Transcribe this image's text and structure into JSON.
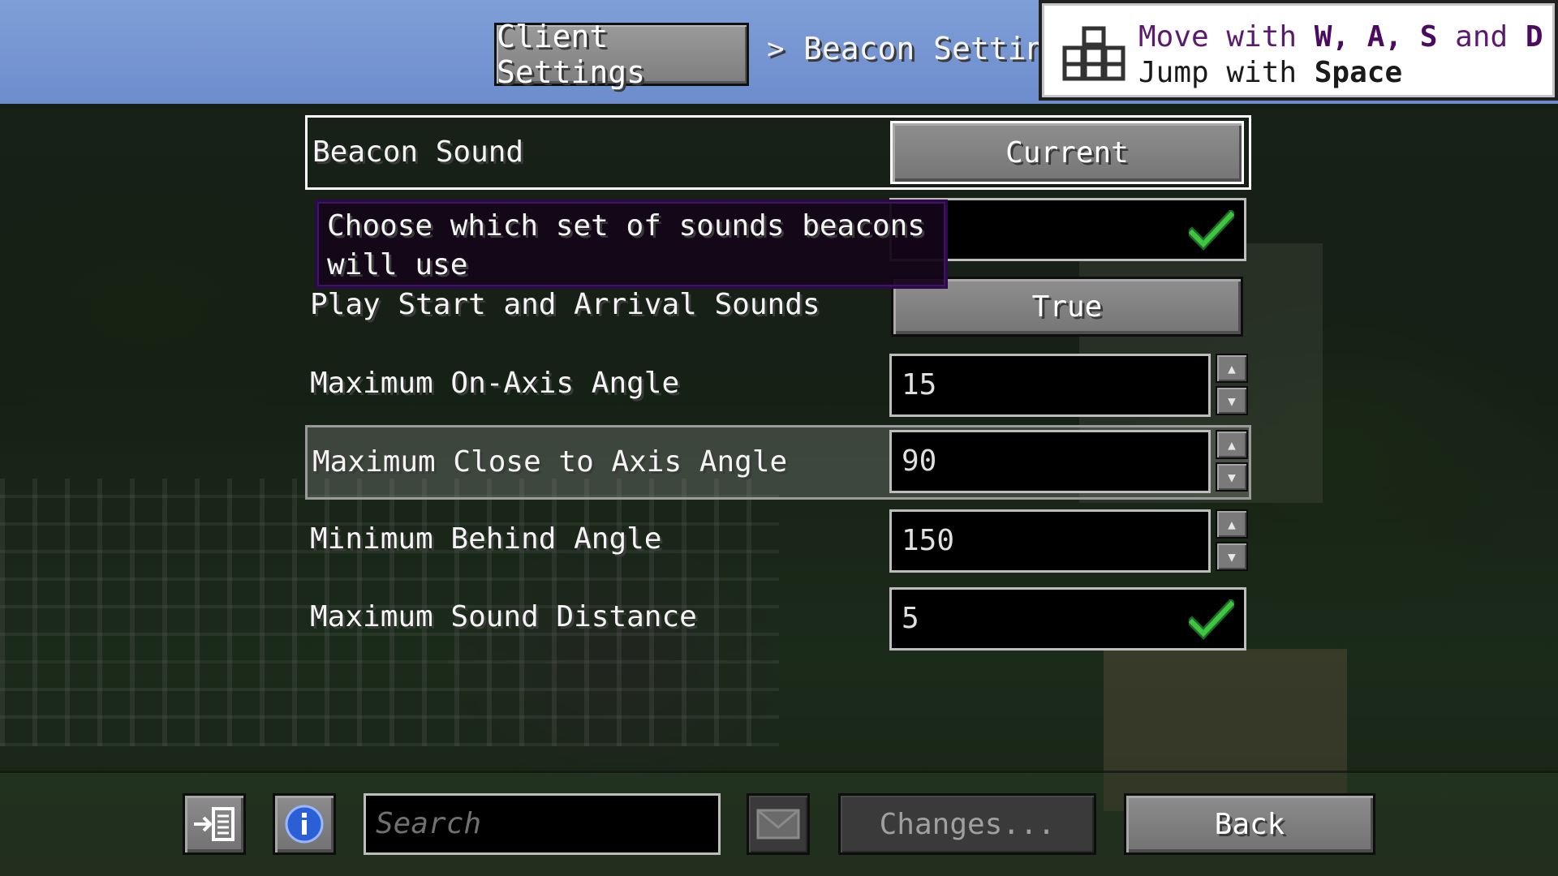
{
  "breadcrumb": {
    "parent": "Client Settings",
    "separator": ">",
    "current": "Beacon Settings"
  },
  "toast": {
    "line1_prefix": "Move with ",
    "line1_keys": "W, A, S",
    "line1_and": " and ",
    "line1_key_last": "D",
    "line2_prefix": "Jump with ",
    "line2_key": "Space"
  },
  "settings": [
    {
      "label": "Beacon Sound",
      "control": "button",
      "value": "Current"
    },
    {
      "label": "",
      "control": "toggle",
      "value": ""
    },
    {
      "label": "Play Start and Arrival Sounds",
      "control": "button",
      "value": "True"
    },
    {
      "label": "Maximum On-Axis Angle",
      "control": "number",
      "value": "15"
    },
    {
      "label": "Maximum Close to Axis Angle",
      "control": "number",
      "value": "90"
    },
    {
      "label": "Minimum Behind Angle",
      "control": "number",
      "value": "150"
    },
    {
      "label": "Maximum Sound Distance",
      "control": "field",
      "value": "5"
    }
  ],
  "tooltip": {
    "line1": "Choose which set of sounds beacons",
    "line2": "will use"
  },
  "footer": {
    "search_placeholder": "Search",
    "changes_label": "Changes...",
    "back_label": "Back"
  },
  "icons": {
    "toast": "keyboard-keys-icon",
    "check": "checkmark-icon",
    "info": "info-icon",
    "export": "export-list-icon",
    "mail": "envelope-icon",
    "spin_up": "arrow-up-icon",
    "spin_down": "arrow-down-icon"
  },
  "colors": {
    "tooltip_bg": "#140518",
    "tooltip_border": "#2c0a47",
    "check_green": "#3ec63e",
    "info_blue": "#2b5fd6",
    "toast_text": "#5a1a6e"
  }
}
